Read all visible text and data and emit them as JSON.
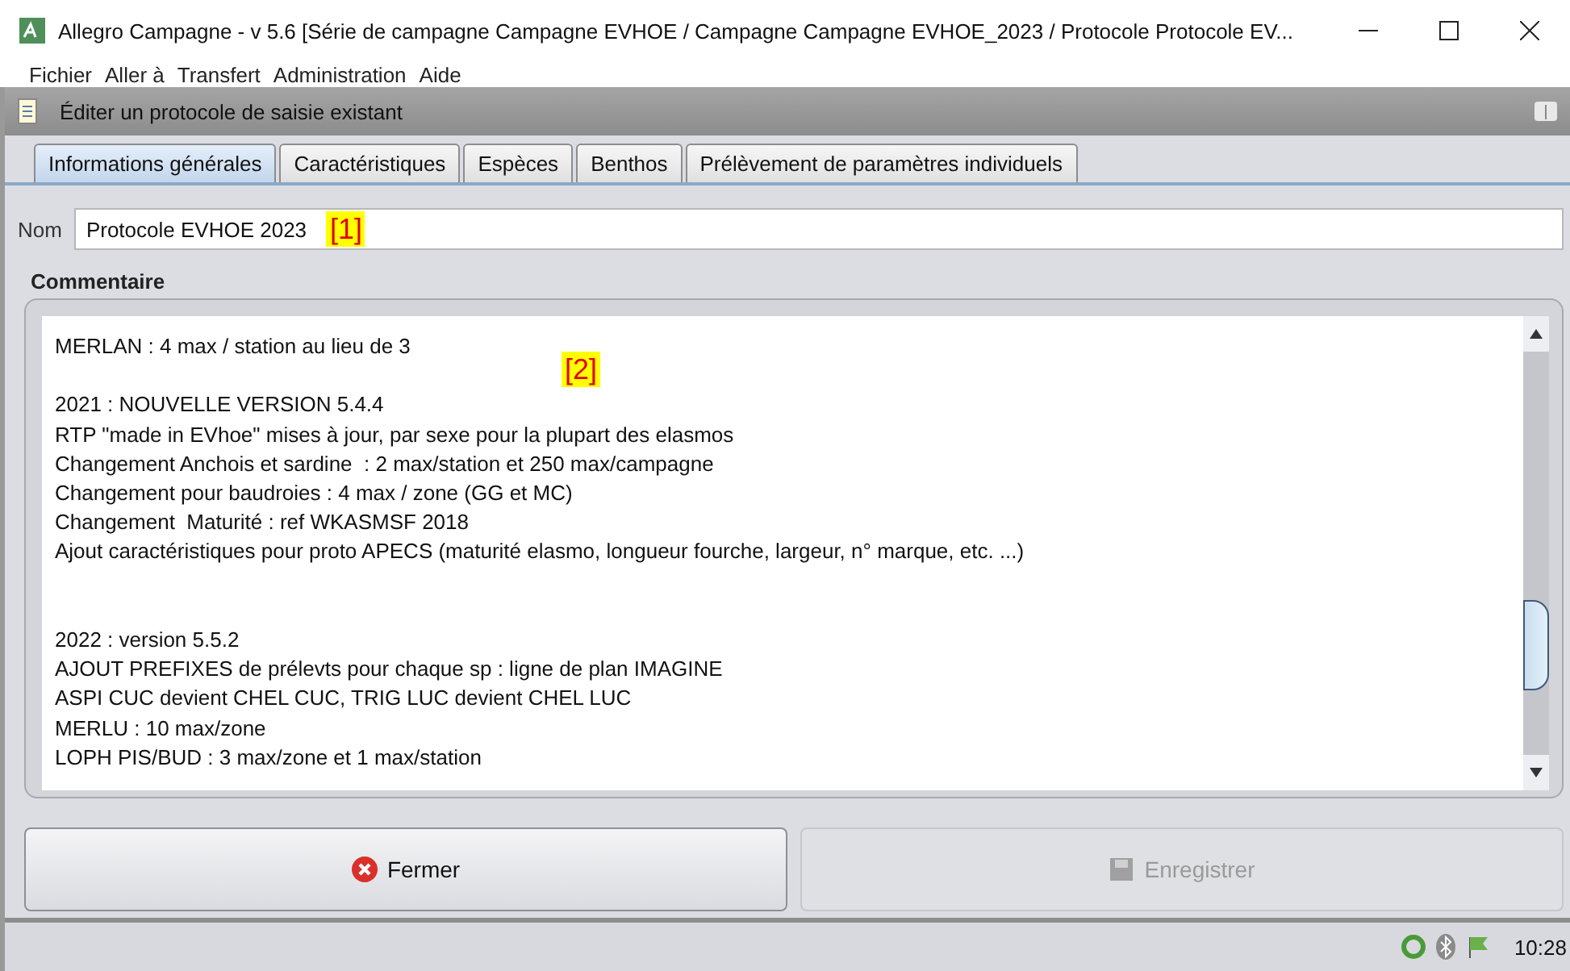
{
  "window": {
    "title": "Allegro Campagne - v 5.6 [Série de campagne Campagne EVHOE / Campagne Campagne EVHOE_2023 / Protocole Protocole EV..."
  },
  "menu": [
    "Fichier",
    "Aller à",
    "Transfert",
    "Administration",
    "Aide"
  ],
  "header": {
    "title": "Éditer un protocole de saisie existant"
  },
  "tabs": [
    {
      "label": "Informations générales",
      "selected": true
    },
    {
      "label": "Caractéristiques",
      "selected": false
    },
    {
      "label": "Espèces",
      "selected": false
    },
    {
      "label": "Benthos",
      "selected": false
    },
    {
      "label": "Prélèvement de paramètres individuels",
      "selected": false
    }
  ],
  "name_field": {
    "label": "Nom",
    "value": "Protocole EVHOE 2023",
    "annotation": "[1]"
  },
  "comment": {
    "label": "Commentaire",
    "annotation": "[2]",
    "value": "MERLAN : 4 max / station au lieu de 3\n\n2021 : NOUVELLE VERSION 5.4.4\nRTP \"made in EVhoe\" mises à jour, par sexe pour la plupart des elasmos\nChangement Anchois et sardine  : 2 max/station et 250 max/campagne\nChangement pour baudroies : 4 max / zone (GG et MC)\nChangement  Maturité : ref WKASMSF 2018\nAjout caractéristiques pour proto APECS (maturité elasmo, longueur fourche, largeur, n° marque, etc. ...)\n\n\n2022 : version 5.5.2\nAJOUT PREFIXES de prélevts pour chaque sp : ligne de plan IMAGINE\nASPI CUC devient CHEL CUC, TRIG LUC devient CHEL LUC\nMERLU : 10 max/zone\nLOPH PIS/BUD : 3 max/zone et 1 max/station"
  },
  "buttons": [
    {
      "label": "Fermer",
      "kind": "close",
      "disabled": false
    },
    {
      "label": "Enregistrer",
      "kind": "save",
      "disabled": true
    }
  ],
  "status_bar": {
    "time": "10:28"
  }
}
